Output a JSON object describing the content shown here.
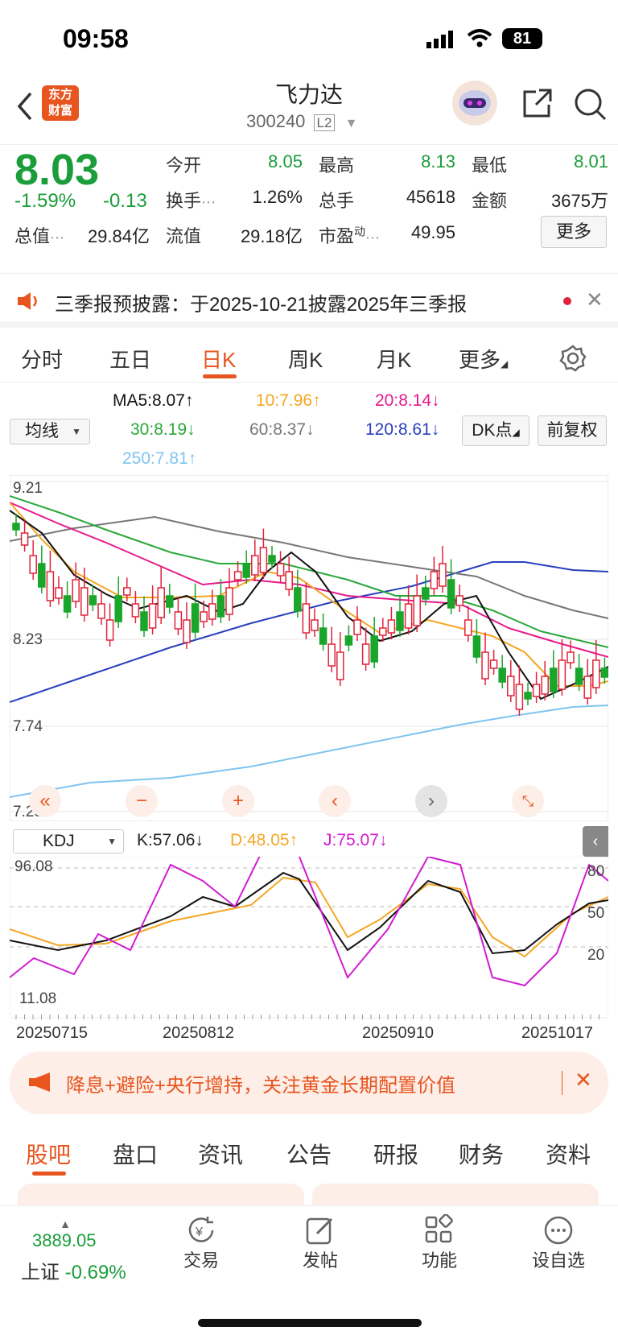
{
  "status": {
    "time": "09:58",
    "battery": "81"
  },
  "header": {
    "name": "飞力达",
    "code": "300240",
    "level": "L2",
    "logo_line1": "东方",
    "logo_line2": "财富"
  },
  "quote": {
    "price": "8.03",
    "pct": "-1.59%",
    "chg": "-0.13",
    "open_l": "今开",
    "open_v": "8.05",
    "high_l": "最高",
    "high_v": "8.13",
    "low_l": "最低",
    "low_v": "8.01",
    "turn_l": "换手",
    "turn_v": "1.26%",
    "vol_l": "总手",
    "vol_v": "45618",
    "amt_l": "金额",
    "amt_v": "3675万",
    "mcap_l": "总值",
    "mcap_v": "29.84亿",
    "float_l": "流值",
    "float_v": "29.18亿",
    "pe_l": "市盈",
    "pe_sup": "动",
    "pe_v": "49.95",
    "more": "更多"
  },
  "notice": {
    "text": "三季报预披露：于2025-10-21披露2025年三季报"
  },
  "tabs": [
    "分时",
    "五日",
    "日K",
    "周K",
    "月K",
    "更多"
  ],
  "ma": {
    "select": "均线",
    "ma5": "MA5:8.07↑",
    "ma10": "10:7.96↑",
    "ma20": "20:8.14↓",
    "ma30": "30:8.19↓",
    "ma60": "60:8.37↓",
    "ma120": "120:8.61↓",
    "ma250": "250:7.81↑",
    "dk": "DK点",
    "fq": "前复权"
  },
  "chart_axis": {
    "y1": "9.21",
    "y2": "8.23",
    "y3": "7.74",
    "y4": "7.25"
  },
  "kdj": {
    "select": "KDJ",
    "k": "K:57.06↓",
    "d": "D:48.05↑",
    "j": "J:75.07↓",
    "top": "96.08",
    "bottom": "11.08",
    "r80": "80",
    "r50": "50",
    "r20": "20"
  },
  "dates": [
    "20250715",
    "20250812",
    "20250910",
    "20251017"
  ],
  "colors": {
    "up": "#e0233a",
    "down": "#1aa52b",
    "ma5": "#111111",
    "ma10": "#f5a623",
    "ma20": "#e6198a",
    "ma30": "#2aa83a",
    "ma60": "#777777",
    "ma120": "#2a3fbf",
    "ma250": "#7fc4f0"
  },
  "ad": {
    "text": "降息+避险+央行增持，关注黄金长期配置价值"
  },
  "bottom_tabs": [
    "股吧",
    "盘口",
    "资讯",
    "公告",
    "研报",
    "财务",
    "资料"
  ],
  "bottom": {
    "index_val": "3889.05",
    "index_name": "上证",
    "index_pct": "-0.69%",
    "trade": "交易",
    "post": "发帖",
    "func": "功能",
    "fav": "设自选"
  }
}
